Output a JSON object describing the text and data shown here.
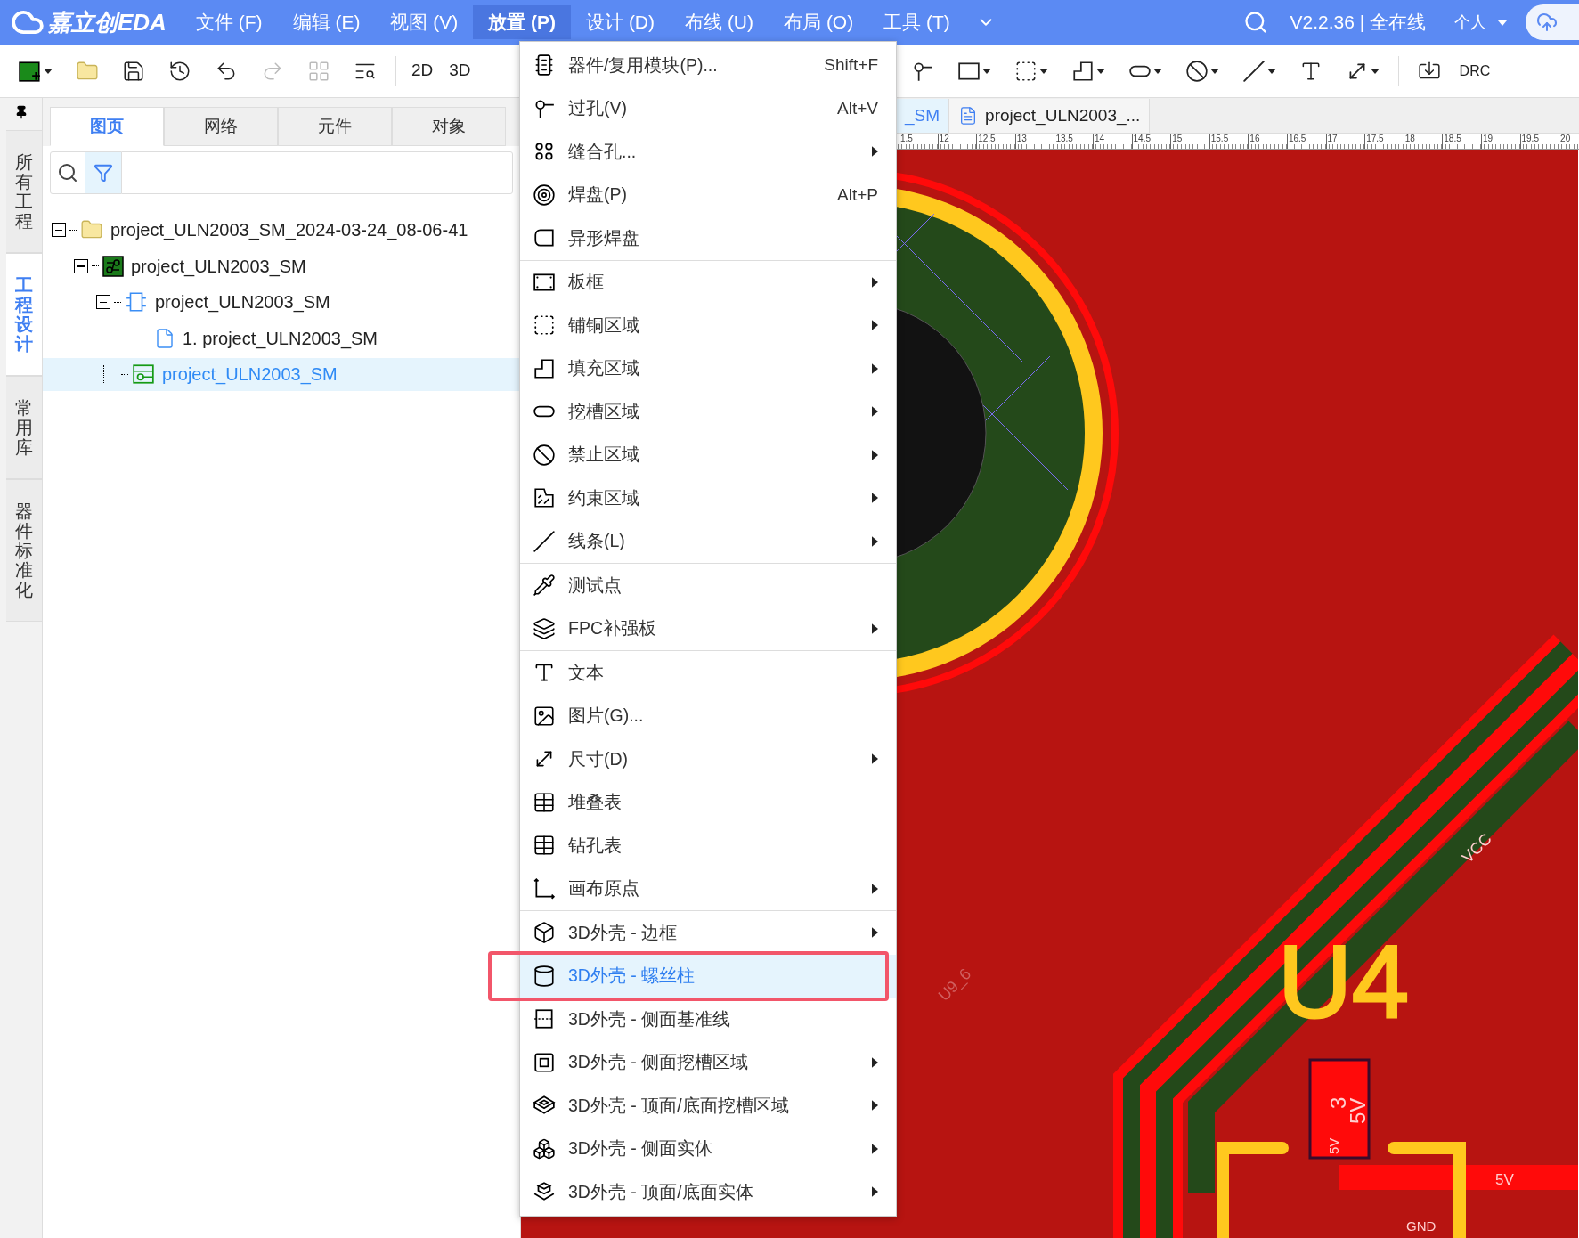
{
  "app": {
    "logo": "嘉立创EDA",
    "version": "V2.2.36 | 全在线",
    "account": "个人"
  },
  "menubar": [
    {
      "label": "文件 (F)",
      "selected": false
    },
    {
      "label": "编辑 (E)",
      "selected": false
    },
    {
      "label": "视图 (V)",
      "selected": false
    },
    {
      "label": "放置 (P)",
      "selected": true
    },
    {
      "label": "设计 (D)",
      "selected": false
    },
    {
      "label": "布线 (U)",
      "selected": false
    },
    {
      "label": "布局 (O)",
      "selected": false
    },
    {
      "label": "工具 (T)",
      "selected": false
    }
  ],
  "toolbar": {
    "view_buttons": [
      "2D",
      "3D"
    ],
    "drc": "DRC"
  },
  "side_tabs": [
    {
      "label": "所有工程",
      "selected": false
    },
    {
      "label": "工程设计",
      "selected": true
    },
    {
      "label": "常用库",
      "selected": false
    },
    {
      "label": "器件标准化",
      "selected": false
    }
  ],
  "panel_tabs": [
    {
      "label": "图页",
      "selected": true
    },
    {
      "label": "网络",
      "selected": false
    },
    {
      "label": "元件",
      "selected": false
    },
    {
      "label": "对象",
      "selected": false
    }
  ],
  "tree": [
    {
      "label": "project_ULN2003_SM_2024-03-24_08-06-41",
      "kind": "project",
      "expanded": true,
      "selected": false,
      "children": [
        {
          "label": "project_ULN2003_SM",
          "kind": "board",
          "expanded": true,
          "selected": false,
          "children": [
            {
              "label": "project_ULN2003_SM",
              "kind": "schematic",
              "expanded": true,
              "selected": false,
              "children": [
                {
                  "label": "1. project_ULN2003_SM",
                  "kind": "page",
                  "selected": false
                }
              ]
            },
            {
              "label": "project_ULN2003_SM",
              "kind": "pcb",
              "selected": true
            }
          ]
        }
      ]
    }
  ],
  "doc_tabs": [
    {
      "label": "_SM",
      "selected": true
    },
    {
      "label": "project_ULN2003_...",
      "selected": false
    }
  ],
  "ruler": [
    "1.5",
    "12",
    "12.5",
    "13",
    "13.5",
    "14",
    "14.5",
    "15",
    "15.5",
    "16",
    "16.5",
    "17",
    "17.5",
    "18",
    "18.5",
    "19",
    "19.5",
    "20"
  ],
  "pcb_labels": {
    "designator": "U4",
    "net_vcc": "VCC",
    "net_ref": "U9_6",
    "pad_number": "3",
    "pad_net": "5V",
    "pad_net_small": "5V",
    "trace_net": "5V",
    "gnd": "GND"
  },
  "menu": {
    "sections": [
      {
        "items": [
          {
            "label": "器件/复用模块(P)...",
            "shortcut": "Shift+F",
            "submenu": false,
            "selected": false
          },
          {
            "label": "过孔(V)",
            "shortcut": "Alt+V",
            "submenu": false,
            "selected": false
          },
          {
            "label": "缝合孔...",
            "submenu": true,
            "selected": false
          },
          {
            "label": "焊盘(P)",
            "shortcut": "Alt+P",
            "submenu": false,
            "selected": false
          },
          {
            "label": "异形焊盘",
            "submenu": false,
            "selected": false
          }
        ]
      },
      {
        "items": [
          {
            "label": "板框",
            "submenu": true,
            "selected": false
          },
          {
            "label": "铺铜区域",
            "submenu": true,
            "selected": false
          },
          {
            "label": "填充区域",
            "submenu": true,
            "selected": false
          },
          {
            "label": "挖槽区域",
            "submenu": true,
            "selected": false
          },
          {
            "label": "禁止区域",
            "submenu": true,
            "selected": false
          },
          {
            "label": "约束区域",
            "submenu": true,
            "selected": false
          },
          {
            "label": "线条(L)",
            "submenu": true,
            "selected": false
          }
        ]
      },
      {
        "items": [
          {
            "label": "测试点",
            "submenu": false,
            "selected": false
          },
          {
            "label": "FPC补强板",
            "submenu": true,
            "selected": false
          }
        ]
      },
      {
        "items": [
          {
            "label": "文本",
            "submenu": false,
            "selected": false
          },
          {
            "label": "图片(G)...",
            "submenu": false,
            "selected": false
          },
          {
            "label": "尺寸(D)",
            "submenu": true,
            "selected": false
          },
          {
            "label": "堆叠表",
            "submenu": false,
            "selected": false
          },
          {
            "label": "钻孔表",
            "submenu": false,
            "selected": false
          },
          {
            "label": "画布原点",
            "submenu": true,
            "selected": false
          }
        ]
      },
      {
        "items": [
          {
            "label": "3D外壳 - 边框",
            "submenu": true,
            "selected": false
          },
          {
            "label": "3D外壳 - 螺丝柱",
            "submenu": false,
            "selected": true
          },
          {
            "label": "3D外壳 - 侧面基准线",
            "submenu": false,
            "selected": false
          },
          {
            "label": "3D外壳 - 侧面挖槽区域",
            "submenu": true,
            "selected": false
          },
          {
            "label": "3D外壳 - 顶面/底面挖槽区域",
            "submenu": true,
            "selected": false
          },
          {
            "label": "3D外壳 - 侧面实体",
            "submenu": true,
            "selected": false
          },
          {
            "label": "3D外壳 - 顶面/底面实体",
            "submenu": true,
            "selected": false
          }
        ]
      }
    ]
  }
}
